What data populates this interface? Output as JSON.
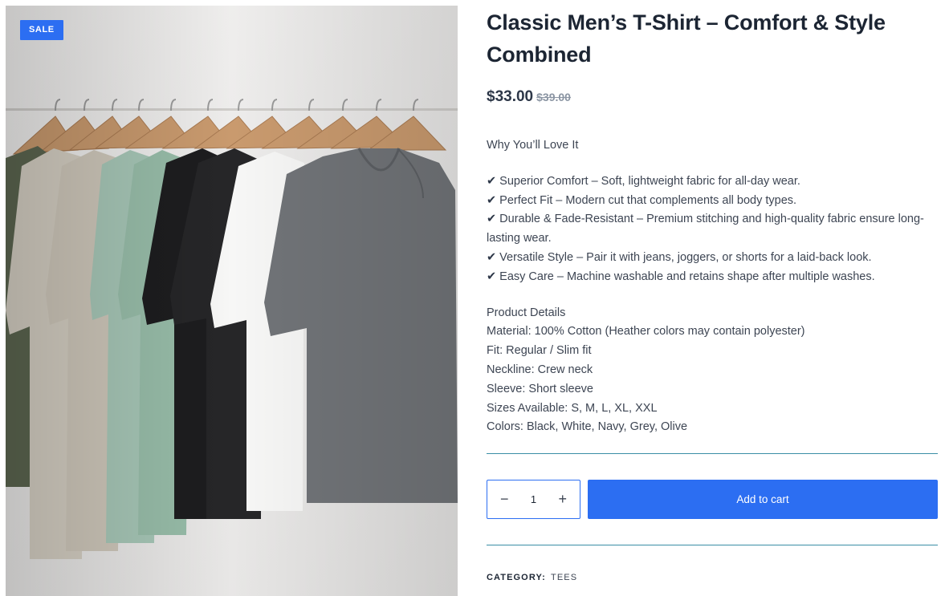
{
  "badge": {
    "sale_label": "SALE"
  },
  "product": {
    "title": "Classic Men’s T-Shirt – Comfort & Style Combined",
    "price_current": "$33.00",
    "price_old": "$39.00",
    "image_alt": "Row of plain t-shirts on wooden hangers"
  },
  "description": {
    "intro": "Why You’ll Love It",
    "check_glyph": "✔",
    "features": [
      "Superior Comfort – Soft, lightweight fabric for all-day wear.",
      "Perfect Fit – Modern cut that complements all body types.",
      "Durable & Fade-Resistant – Premium stitching and high-quality fabric ensure long-lasting wear.",
      "Versatile Style – Pair it with jeans, joggers, or shorts for a laid-back look.",
      "Easy Care – Machine washable and retains shape after multiple washes."
    ],
    "details_heading": "Product Details",
    "details": [
      "Material: 100% Cotton (Heather colors may contain polyester)",
      "Fit: Regular / Slim fit",
      "Neckline: Crew neck",
      "Sleeve: Short sleeve",
      "Sizes Available: S, M, L, XL, XXL",
      "Colors: Black, White, Navy, Grey, Olive"
    ]
  },
  "cart": {
    "minus_glyph": "−",
    "plus_glyph": "+",
    "quantity": "1",
    "add_to_cart_label": "Add to cart"
  },
  "meta": {
    "category_label": "CATEGORY:",
    "category_value": "TEES"
  },
  "colors": {
    "accent": "#2c6ef2",
    "divider": "#3a8fa6",
    "title": "#1c2533",
    "price_old": "#8b95a3"
  }
}
